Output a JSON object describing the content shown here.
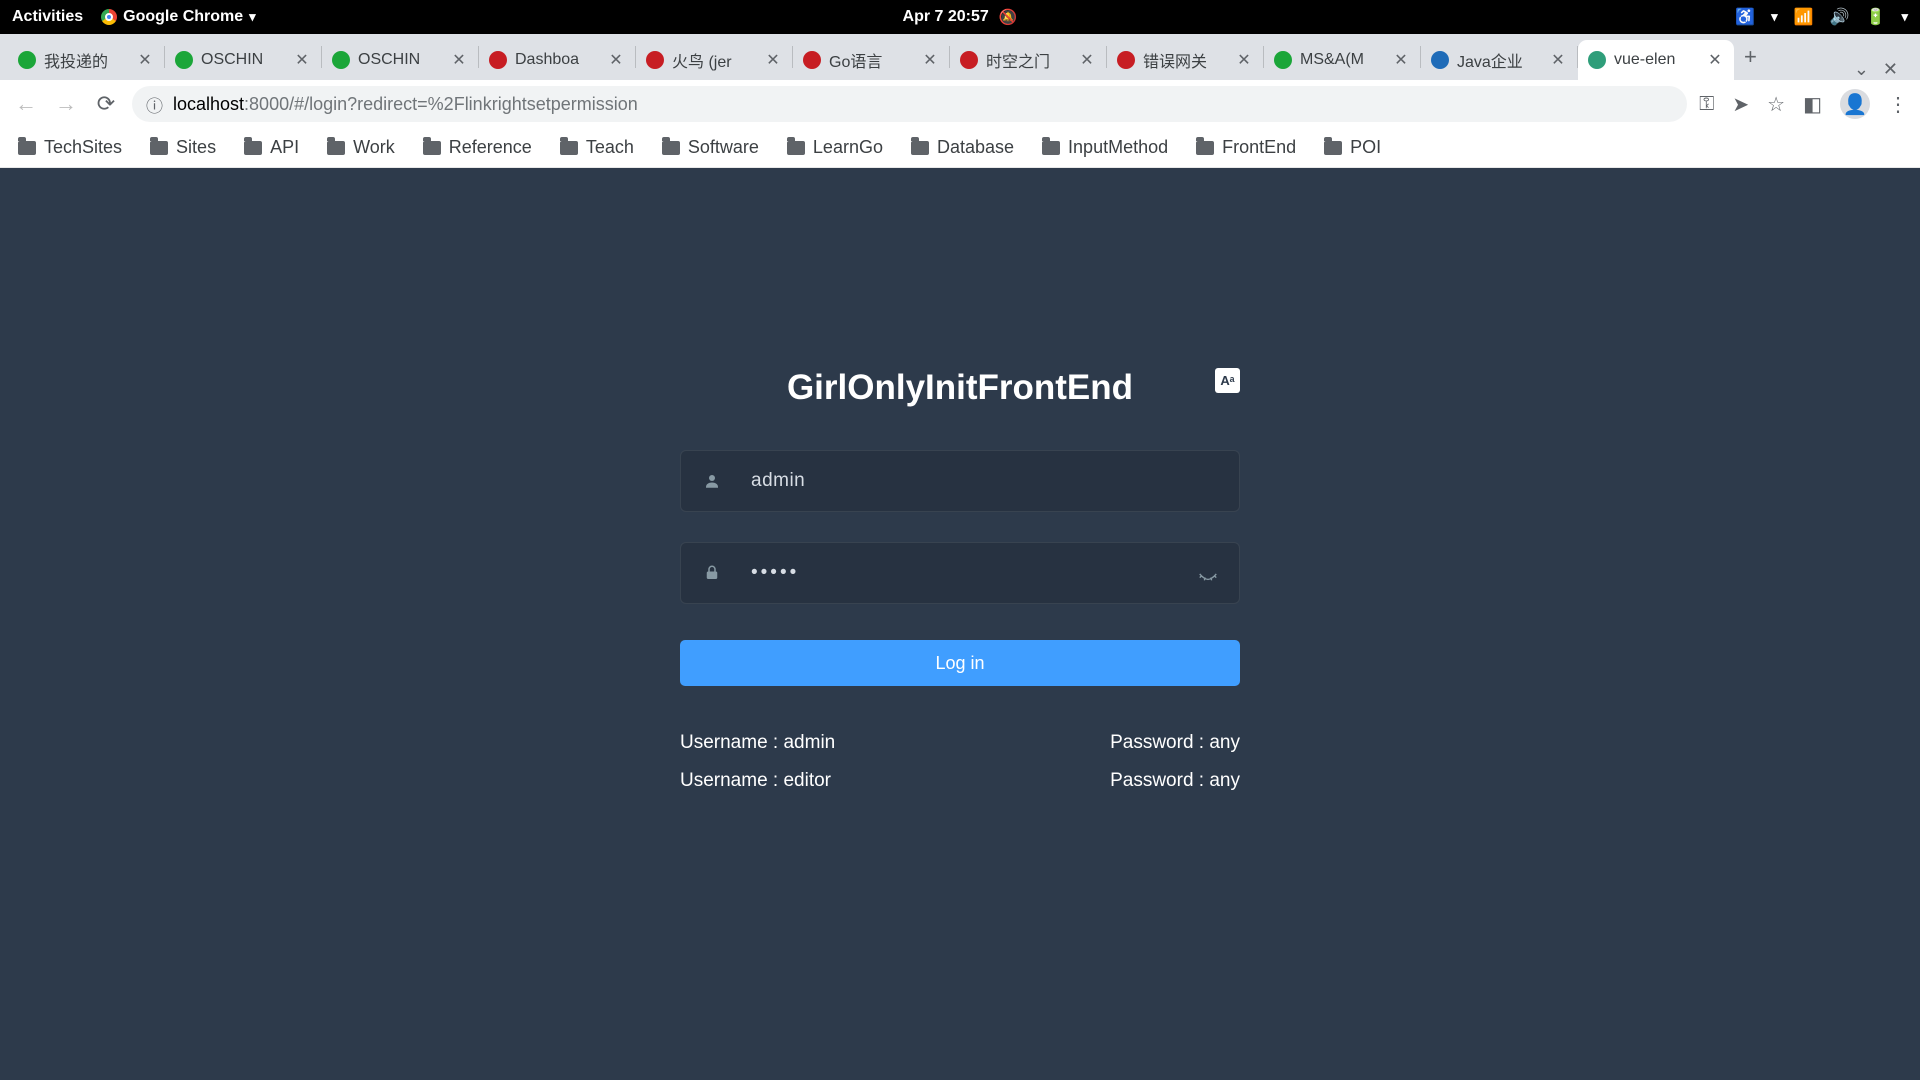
{
  "gnome": {
    "activities": "Activities",
    "app_name": "Google Chrome",
    "clock": "Apr 7  20:57"
  },
  "tabs": [
    {
      "fav": "green",
      "label": "我投递的"
    },
    {
      "fav": "green",
      "label": "OSCHIN"
    },
    {
      "fav": "green",
      "label": "OSCHIN"
    },
    {
      "fav": "red",
      "label": "Dashboa"
    },
    {
      "fav": "red",
      "label": "火鸟 (jer"
    },
    {
      "fav": "red",
      "label": "Go语言"
    },
    {
      "fav": "red",
      "label": "时空之门"
    },
    {
      "fav": "red",
      "label": "错误网关"
    },
    {
      "fav": "green",
      "label": "MS&A(M"
    },
    {
      "fav": "blue",
      "label": "Java企业"
    },
    {
      "fav": "teal",
      "label": "vue-elen",
      "active": true
    }
  ],
  "addr": {
    "prefix": "localhost",
    "rest": ":8000/#/login?redirect=%2Flinkrightsetpermission"
  },
  "bookmarks": [
    "TechSites",
    "Sites",
    "API",
    "Work",
    "Reference",
    "Teach",
    "Software",
    "LearnGo",
    "Database",
    "InputMethod",
    "FrontEnd",
    "POI"
  ],
  "login": {
    "title": "GirlOnlyInitFrontEnd",
    "username_value": "admin",
    "password_value": "•••••",
    "btn": "Log in",
    "hint_user1": "Username : admin",
    "hint_pass1": "Password : any",
    "hint_user2": "Username : editor",
    "hint_pass2": "Password : any"
  }
}
